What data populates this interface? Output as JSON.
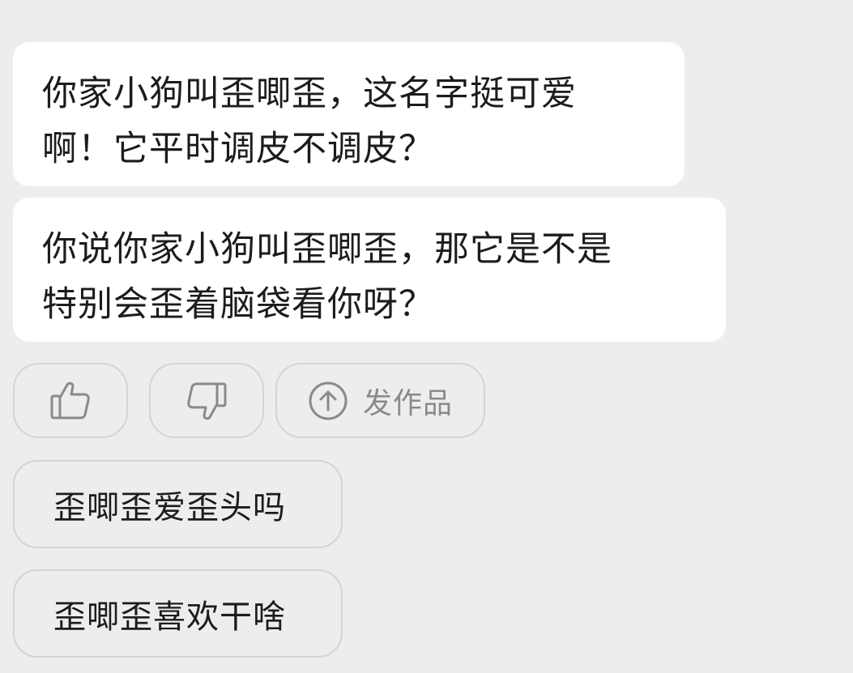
{
  "messages": [
    {
      "lines": [
        "你家小狗叫歪唧歪，这名字挺可爱",
        "啊！它平时调皮不调皮？"
      ]
    },
    {
      "lines": [
        "你说你家小狗叫歪唧歪，那它是不是",
        "特别会歪着脑袋看你呀？"
      ]
    }
  ],
  "actions": {
    "like_icon": "thumbs-up-icon",
    "dislike_icon": "thumbs-down-icon",
    "publish_icon": "arrow-up-circle-icon",
    "publish_label": "发作品"
  },
  "suggestions": [
    "歪唧歪爱歪头吗",
    "歪唧歪喜欢干啥"
  ],
  "colors": {
    "background": "#ededed",
    "bubble": "#ffffff",
    "border": "#d4d4d4",
    "icon": "#8a8a8a",
    "text": "#1c1c1c"
  }
}
